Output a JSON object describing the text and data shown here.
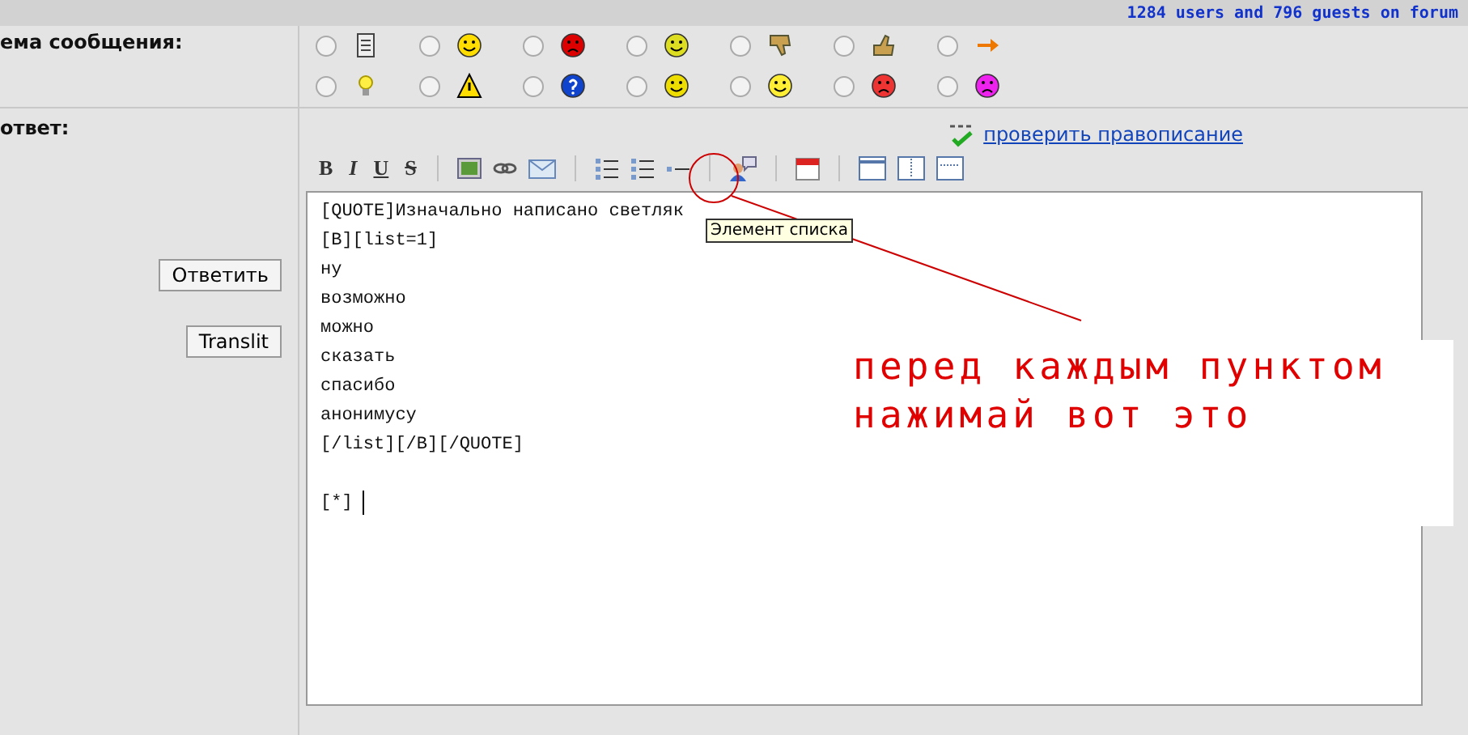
{
  "status_bar": {
    "text": "1284 users and 796 guests on forum"
  },
  "subject_row": {
    "label": "ема сообщения:",
    "icons": [
      {
        "kind": "document",
        "selected": false
      },
      {
        "kind": "grin",
        "selected": false
      },
      {
        "kind": "angry",
        "selected": false
      },
      {
        "kind": "smile",
        "selected": false
      },
      {
        "kind": "thumbs-down",
        "selected": false
      },
      {
        "kind": "thumbs-up",
        "selected": false
      },
      {
        "kind": "arrow",
        "selected": false
      },
      {
        "kind": "lightbulb",
        "selected": false
      },
      {
        "kind": "warning",
        "selected": false
      },
      {
        "kind": "question",
        "selected": false
      },
      {
        "kind": "cool",
        "selected": false
      },
      {
        "kind": "happy",
        "selected": false
      },
      {
        "kind": "sad",
        "selected": false
      },
      {
        "kind": "frown",
        "selected": false
      }
    ]
  },
  "reply_row": {
    "label": "ответ:",
    "buttons": [
      "Ответить",
      "Translit"
    ],
    "spellcheck_link": "проверить правописание",
    "toolbar": [
      {
        "kind": "bold",
        "text": "B"
      },
      {
        "kind": "italic",
        "text": "I"
      },
      {
        "kind": "underline",
        "text": "U"
      },
      {
        "kind": "strike",
        "text": "S"
      },
      {
        "kind": "sep"
      },
      {
        "kind": "image"
      },
      {
        "kind": "link"
      },
      {
        "kind": "email"
      },
      {
        "kind": "sep"
      },
      {
        "kind": "bullets"
      },
      {
        "kind": "numbers"
      },
      {
        "kind": "list-item"
      },
      {
        "kind": "sep"
      },
      {
        "kind": "person"
      },
      {
        "kind": "sep"
      },
      {
        "kind": "calendar"
      },
      {
        "kind": "sep"
      },
      {
        "kind": "layout-top"
      },
      {
        "kind": "layout-split"
      },
      {
        "kind": "layout-dotted"
      }
    ],
    "tooltip": "Элемент списка",
    "message_text": "[QUOTE]Изначально написано светляк\n[B][list=1]\nну\nвозможно\nможно\nсказать\nспасибо\nанонимусу\n[/list][/B][/QUOTE]\n\n[*] "
  },
  "annotation": {
    "lines": [
      "перед каждым пунктом",
      "нажимай вот это"
    ]
  }
}
